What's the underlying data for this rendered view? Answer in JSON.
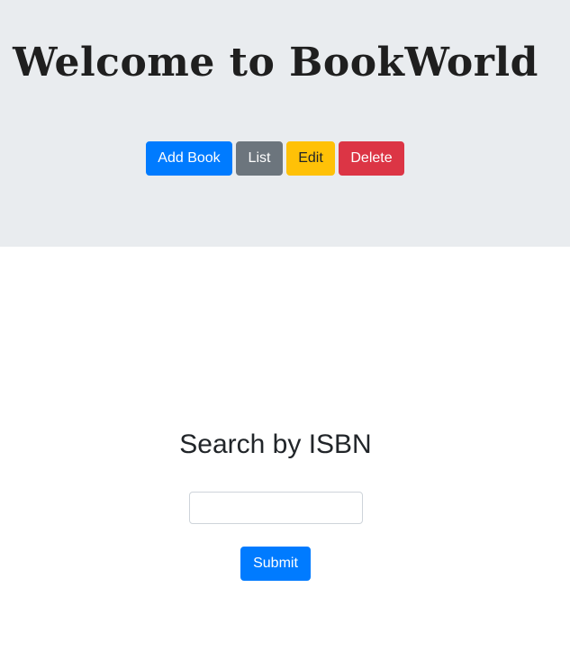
{
  "header": {
    "title": "Welcome to BookWorld"
  },
  "nav": {
    "add_label": "Add Book",
    "list_label": "List",
    "edit_label": "Edit",
    "delete_label": "Delete"
  },
  "search": {
    "heading": "Search by ISBN",
    "input_value": "",
    "input_placeholder": "",
    "submit_label": "Submit"
  },
  "colors": {
    "jumbotron_bg": "#e9ecef",
    "primary": "#007bff",
    "secondary": "#6c757d",
    "warning": "#ffc107",
    "danger": "#dc3545"
  }
}
